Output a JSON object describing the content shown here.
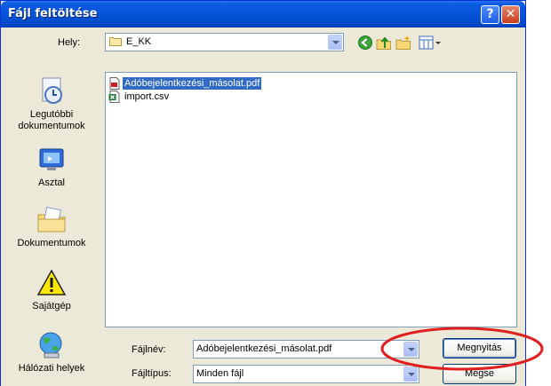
{
  "window": {
    "title": "Fájl feltöltése",
    "help_glyph": "?",
    "close_glyph": "✕"
  },
  "look_in": {
    "label": "Hely:",
    "value": "E_KK"
  },
  "toolbar": {
    "icons": [
      "back-icon",
      "up-folder-icon",
      "new-folder-icon",
      "views-menu-icon"
    ]
  },
  "places": [
    {
      "label_line1": "Legutóbbi",
      "label_line2": "dokumentumok",
      "icon": "recent-documents-icon"
    },
    {
      "label_line1": "Asztal",
      "label_line2": "",
      "icon": "desktop-icon"
    },
    {
      "label_line1": "Dokumentumok",
      "label_line2": "",
      "icon": "my-documents-icon"
    },
    {
      "label_line1": "Sajátgép",
      "label_line2": "",
      "icon": "my-computer-icon"
    },
    {
      "label_line1": "Hálózati helyek",
      "label_line2": "",
      "icon": "network-places-icon"
    }
  ],
  "files": [
    {
      "name": "Adóbejelentkezési_másolat.pdf",
      "selected": true,
      "icon": "pdf-file-icon"
    },
    {
      "name": "import.csv",
      "selected": false,
      "icon": "csv-file-icon"
    }
  ],
  "filename": {
    "label": "Fájlnév:",
    "value": "Adóbejelentkezési_másolat.pdf"
  },
  "filetype": {
    "label": "Fájltípus:",
    "value": "Minden fájl"
  },
  "buttons": {
    "open": "Megnyitás",
    "cancel": "Mégse"
  },
  "colors": {
    "titlebar": "#0554d8",
    "dialog_bg": "#ece9d8",
    "selection": "#316ac5",
    "annotation_red": "#e02020"
  }
}
